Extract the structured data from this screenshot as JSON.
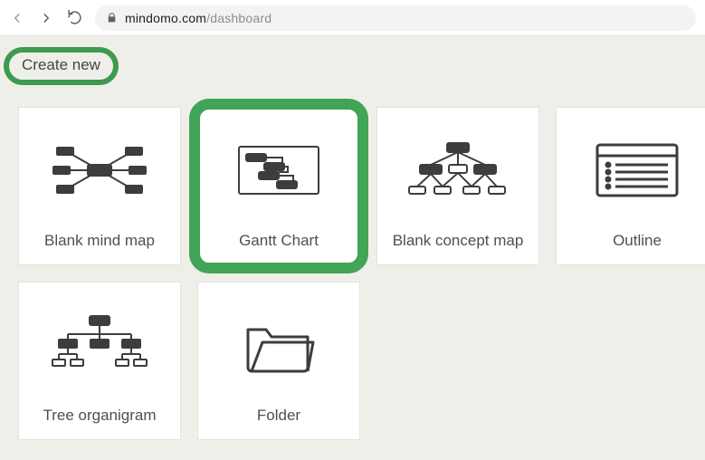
{
  "browser": {
    "url_host": "mindomo.com",
    "url_path": "/dashboard"
  },
  "header": {
    "create_label": "Create new"
  },
  "cards": {
    "mind_map": "Blank mind map",
    "gantt": "Gantt Chart",
    "concept_map": "Blank concept map",
    "outline": "Outline",
    "tree": "Tree organigram",
    "folder": "Folder"
  }
}
